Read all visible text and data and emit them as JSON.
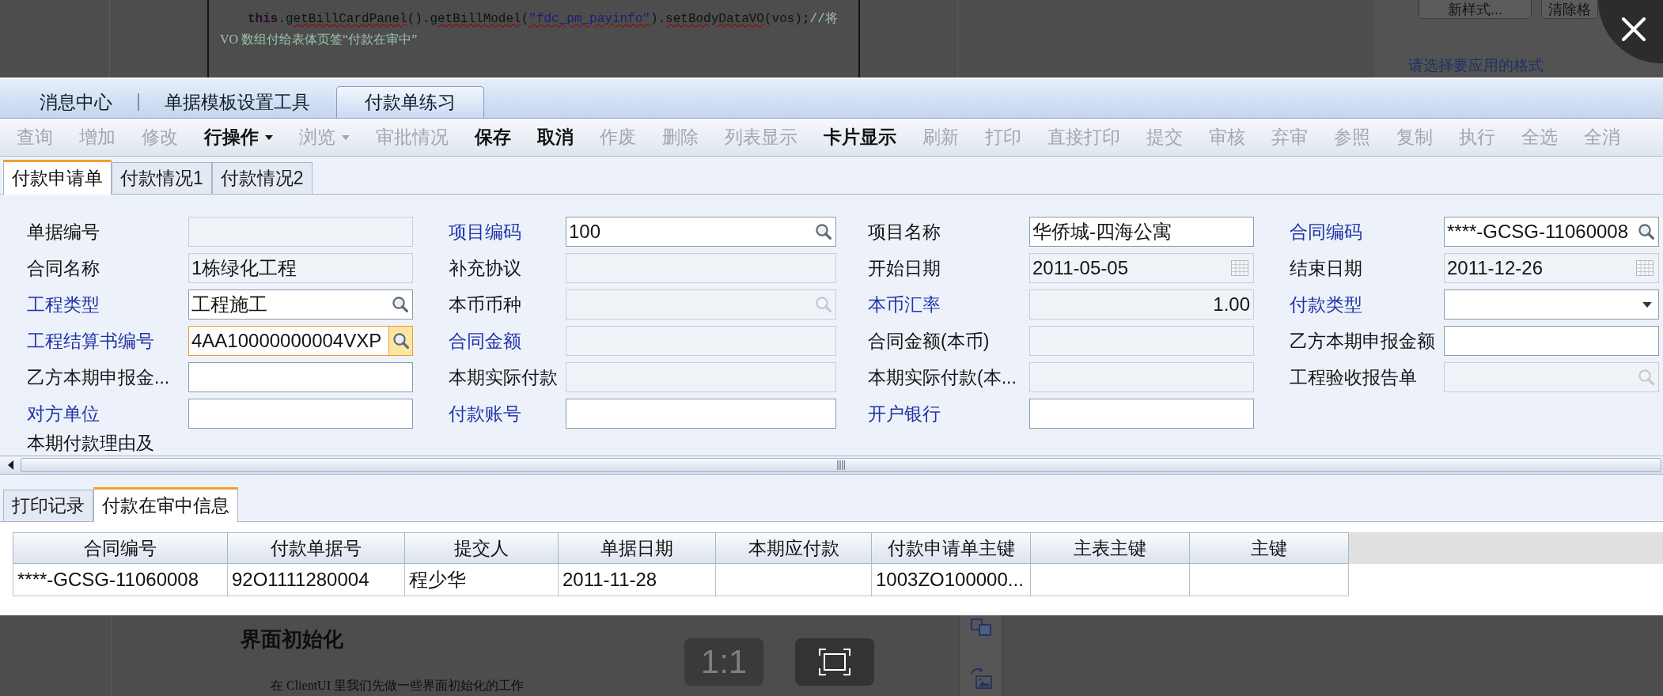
{
  "document": {
    "code_tokens": [
      {
        "kind": "keyword",
        "text": "this",
        "squiggle": false
      },
      {
        "kind": "plain",
        "text": ".",
        "squiggle": false
      },
      {
        "kind": "plain",
        "text": "getBillCardPanel",
        "squiggle": true
      },
      {
        "kind": "plain",
        "text": "().",
        "squiggle": false
      },
      {
        "kind": "plain",
        "text": "getBillModel",
        "squiggle": true
      },
      {
        "kind": "plain",
        "text": "(",
        "squiggle": false
      },
      {
        "kind": "string",
        "text": "\"fdc_pm_payinfo\"",
        "squiggle": true
      },
      {
        "kind": "plain",
        "text": ").",
        "squiggle": false
      },
      {
        "kind": "plain",
        "text": "setBodyDataVO",
        "squiggle": true
      },
      {
        "kind": "plain",
        "text": "(vos);",
        "squiggle": false
      },
      {
        "kind": "comment",
        "text": "//将",
        "squiggle": false
      }
    ],
    "comment_line": "VO 数组付给表体页签“付款在审中”",
    "style_buttons": [
      "新样式...",
      "清除格"
    ],
    "style_hint": "请选择要应用的格式",
    "heading": "界面初始化",
    "paragraph": "在 ClientUI 里我们先做一些界面初始化的工作"
  },
  "viewer": {
    "actual_size_button": "1:1"
  },
  "app": {
    "tabs": [
      {
        "label": "消息中心",
        "selected": false
      },
      {
        "label": "单据模板设置工具",
        "selected": false
      },
      {
        "label": "付款单练习",
        "selected": true
      }
    ],
    "toolbar": [
      {
        "label": "查询",
        "enabled": false,
        "dropdown": false
      },
      {
        "label": "增加",
        "enabled": false,
        "dropdown": false
      },
      {
        "label": "修改",
        "enabled": false,
        "dropdown": false
      },
      {
        "label": "行操作",
        "enabled": true,
        "dropdown": true
      },
      {
        "label": "浏览",
        "enabled": false,
        "dropdown": true
      },
      {
        "label": "审批情况",
        "enabled": false,
        "dropdown": false
      },
      {
        "label": "保存",
        "enabled": true,
        "dropdown": false
      },
      {
        "label": "取消",
        "enabled": true,
        "dropdown": false
      },
      {
        "label": "作废",
        "enabled": false,
        "dropdown": false
      },
      {
        "label": "删除",
        "enabled": false,
        "dropdown": false
      },
      {
        "label": "列表显示",
        "enabled": false,
        "dropdown": false
      },
      {
        "label": "卡片显示",
        "enabled": true,
        "dropdown": false
      },
      {
        "label": "刷新",
        "enabled": false,
        "dropdown": false
      },
      {
        "label": "打印",
        "enabled": false,
        "dropdown": false
      },
      {
        "label": "直接打印",
        "enabled": false,
        "dropdown": false
      },
      {
        "label": "提交",
        "enabled": false,
        "dropdown": false
      },
      {
        "label": "审核",
        "enabled": false,
        "dropdown": false
      },
      {
        "label": "弃审",
        "enabled": false,
        "dropdown": false
      },
      {
        "label": "参照",
        "enabled": false,
        "dropdown": false
      },
      {
        "label": "复制",
        "enabled": false,
        "dropdown": false
      },
      {
        "label": "执行",
        "enabled": false,
        "dropdown": false
      },
      {
        "label": "全选",
        "enabled": false,
        "dropdown": false
      },
      {
        "label": "全消",
        "enabled": false,
        "dropdown": false
      }
    ],
    "card_tabs": [
      {
        "label": "付款申请单",
        "selected": true
      },
      {
        "label": "付款情况1",
        "selected": false
      },
      {
        "label": "付款情况2",
        "selected": false
      }
    ],
    "form": {
      "rows": [
        [
          {
            "label": "单据编号",
            "required": false,
            "kind": "text",
            "disabled": true,
            "focused": false
          },
          {
            "label": "项目编码",
            "required": true,
            "kind": "lookup",
            "value": "100",
            "disabled": false,
            "focused": false
          },
          {
            "label": "项目名称",
            "required": false,
            "kind": "text",
            "value": "华侨城-四海公寓",
            "disabled": false,
            "focused": false
          },
          {
            "label": "合同编码",
            "required": true,
            "kind": "lookup",
            "value": "****-GCSG-11060008",
            "disabled": false,
            "focused": false
          }
        ],
        [
          {
            "label": "合同名称",
            "required": false,
            "kind": "text",
            "value": "1栋绿化工程",
            "disabled": true,
            "focused": false
          },
          {
            "label": "补充协议",
            "required": false,
            "kind": "text",
            "disabled": true,
            "focused": false
          },
          {
            "label": "开始日期",
            "required": false,
            "kind": "date",
            "value": "2011-05-05",
            "disabled": true,
            "focused": false
          },
          {
            "label": "结束日期",
            "required": false,
            "kind": "date",
            "value": "2011-12-26",
            "disabled": true,
            "focused": false
          }
        ],
        [
          {
            "label": "工程类型",
            "required": true,
            "kind": "lookup",
            "value": "工程施工",
            "disabled": false,
            "focused": false
          },
          {
            "label": "本币币种",
            "required": false,
            "kind": "lookup",
            "disabled": true,
            "focused": false
          },
          {
            "label": "本币汇率",
            "required": true,
            "kind": "number",
            "value": "1.00",
            "disabled": true,
            "focused": false
          },
          {
            "label": "付款类型",
            "required": true,
            "kind": "combo",
            "disabled": false,
            "focused": false
          }
        ],
        [
          {
            "label": "工程结算书编号",
            "required": true,
            "kind": "lookup",
            "value": "4AA10000000004VXP",
            "disabled": false,
            "focused": true
          },
          {
            "label": "合同金额",
            "required": true,
            "kind": "number",
            "disabled": true,
            "focused": false
          },
          {
            "label": "合同金额(本币)",
            "required": false,
            "kind": "number",
            "disabled": true,
            "focused": false
          },
          {
            "label": "乙方本期申报金额",
            "required": false,
            "kind": "number",
            "disabled": false,
            "focused": false
          }
        ],
        [
          {
            "label": "乙方本期申报金...",
            "required": false,
            "kind": "number",
            "disabled": false,
            "focused": false
          },
          {
            "label": "本期实际付款",
            "required": false,
            "kind": "number",
            "disabled": true,
            "focused": false
          },
          {
            "label": "本期实际付款(本...",
            "required": false,
            "kind": "number",
            "disabled": true,
            "focused": false
          },
          {
            "label": "工程验收报告单",
            "required": false,
            "kind": "lookup",
            "disabled": true,
            "focused": false
          }
        ],
        [
          {
            "label": "对方单位",
            "required": true,
            "kind": "text",
            "disabled": false,
            "focused": false
          },
          {
            "label": "付款账号",
            "required": true,
            "kind": "text",
            "disabled": false,
            "focused": false
          },
          {
            "label": "开户银行",
            "required": true,
            "kind": "text",
            "disabled": false,
            "focused": false
          }
        ]
      ],
      "cut_label": "本期付款理由及"
    },
    "body_tabs": [
      {
        "label": "打印记录",
        "selected": false
      },
      {
        "label": "付款在审中信息",
        "selected": true
      }
    ],
    "table": {
      "columns": [
        "合同编号",
        "付款单据号",
        "提交人",
        "单据日期",
        "本期应付款",
        "付款申请单主键",
        "主表主键",
        "主键"
      ],
      "rows": [
        [
          "****-GCSG-11060008",
          "92O1111280004",
          "程少华",
          "2011-11-28",
          null,
          "1003ZO100000...",
          null,
          null
        ]
      ]
    }
  }
}
